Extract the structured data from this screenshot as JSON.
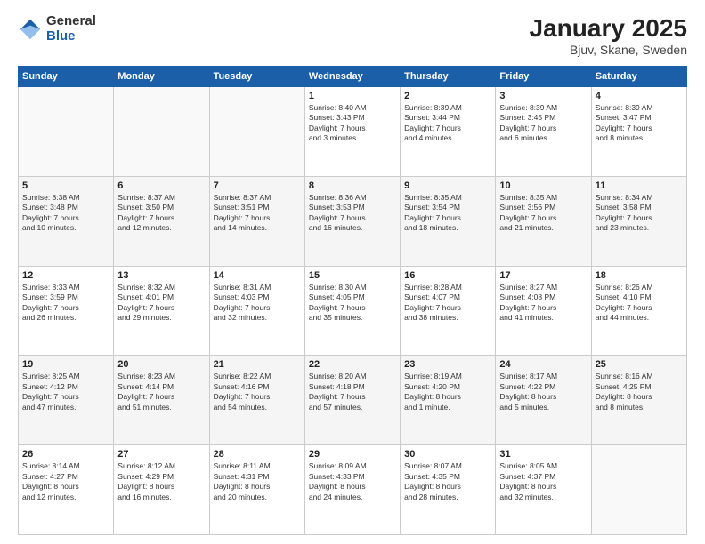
{
  "header": {
    "logo_general": "General",
    "logo_blue": "Blue",
    "title": "January 2025",
    "subtitle": "Bjuv, Skane, Sweden"
  },
  "days_of_week": [
    "Sunday",
    "Monday",
    "Tuesday",
    "Wednesday",
    "Thursday",
    "Friday",
    "Saturday"
  ],
  "weeks": [
    [
      {
        "day": "",
        "info": ""
      },
      {
        "day": "",
        "info": ""
      },
      {
        "day": "",
        "info": ""
      },
      {
        "day": "1",
        "info": "Sunrise: 8:40 AM\nSunset: 3:43 PM\nDaylight: 7 hours\nand 3 minutes."
      },
      {
        "day": "2",
        "info": "Sunrise: 8:39 AM\nSunset: 3:44 PM\nDaylight: 7 hours\nand 4 minutes."
      },
      {
        "day": "3",
        "info": "Sunrise: 8:39 AM\nSunset: 3:45 PM\nDaylight: 7 hours\nand 6 minutes."
      },
      {
        "day": "4",
        "info": "Sunrise: 8:39 AM\nSunset: 3:47 PM\nDaylight: 7 hours\nand 8 minutes."
      }
    ],
    [
      {
        "day": "5",
        "info": "Sunrise: 8:38 AM\nSunset: 3:48 PM\nDaylight: 7 hours\nand 10 minutes."
      },
      {
        "day": "6",
        "info": "Sunrise: 8:37 AM\nSunset: 3:50 PM\nDaylight: 7 hours\nand 12 minutes."
      },
      {
        "day": "7",
        "info": "Sunrise: 8:37 AM\nSunset: 3:51 PM\nDaylight: 7 hours\nand 14 minutes."
      },
      {
        "day": "8",
        "info": "Sunrise: 8:36 AM\nSunset: 3:53 PM\nDaylight: 7 hours\nand 16 minutes."
      },
      {
        "day": "9",
        "info": "Sunrise: 8:35 AM\nSunset: 3:54 PM\nDaylight: 7 hours\nand 18 minutes."
      },
      {
        "day": "10",
        "info": "Sunrise: 8:35 AM\nSunset: 3:56 PM\nDaylight: 7 hours\nand 21 minutes."
      },
      {
        "day": "11",
        "info": "Sunrise: 8:34 AM\nSunset: 3:58 PM\nDaylight: 7 hours\nand 23 minutes."
      }
    ],
    [
      {
        "day": "12",
        "info": "Sunrise: 8:33 AM\nSunset: 3:59 PM\nDaylight: 7 hours\nand 26 minutes."
      },
      {
        "day": "13",
        "info": "Sunrise: 8:32 AM\nSunset: 4:01 PM\nDaylight: 7 hours\nand 29 minutes."
      },
      {
        "day": "14",
        "info": "Sunrise: 8:31 AM\nSunset: 4:03 PM\nDaylight: 7 hours\nand 32 minutes."
      },
      {
        "day": "15",
        "info": "Sunrise: 8:30 AM\nSunset: 4:05 PM\nDaylight: 7 hours\nand 35 minutes."
      },
      {
        "day": "16",
        "info": "Sunrise: 8:28 AM\nSunset: 4:07 PM\nDaylight: 7 hours\nand 38 minutes."
      },
      {
        "day": "17",
        "info": "Sunrise: 8:27 AM\nSunset: 4:08 PM\nDaylight: 7 hours\nand 41 minutes."
      },
      {
        "day": "18",
        "info": "Sunrise: 8:26 AM\nSunset: 4:10 PM\nDaylight: 7 hours\nand 44 minutes."
      }
    ],
    [
      {
        "day": "19",
        "info": "Sunrise: 8:25 AM\nSunset: 4:12 PM\nDaylight: 7 hours\nand 47 minutes."
      },
      {
        "day": "20",
        "info": "Sunrise: 8:23 AM\nSunset: 4:14 PM\nDaylight: 7 hours\nand 51 minutes."
      },
      {
        "day": "21",
        "info": "Sunrise: 8:22 AM\nSunset: 4:16 PM\nDaylight: 7 hours\nand 54 minutes."
      },
      {
        "day": "22",
        "info": "Sunrise: 8:20 AM\nSunset: 4:18 PM\nDaylight: 7 hours\nand 57 minutes."
      },
      {
        "day": "23",
        "info": "Sunrise: 8:19 AM\nSunset: 4:20 PM\nDaylight: 8 hours\nand 1 minute."
      },
      {
        "day": "24",
        "info": "Sunrise: 8:17 AM\nSunset: 4:22 PM\nDaylight: 8 hours\nand 5 minutes."
      },
      {
        "day": "25",
        "info": "Sunrise: 8:16 AM\nSunset: 4:25 PM\nDaylight: 8 hours\nand 8 minutes."
      }
    ],
    [
      {
        "day": "26",
        "info": "Sunrise: 8:14 AM\nSunset: 4:27 PM\nDaylight: 8 hours\nand 12 minutes."
      },
      {
        "day": "27",
        "info": "Sunrise: 8:12 AM\nSunset: 4:29 PM\nDaylight: 8 hours\nand 16 minutes."
      },
      {
        "day": "28",
        "info": "Sunrise: 8:11 AM\nSunset: 4:31 PM\nDaylight: 8 hours\nand 20 minutes."
      },
      {
        "day": "29",
        "info": "Sunrise: 8:09 AM\nSunset: 4:33 PM\nDaylight: 8 hours\nand 24 minutes."
      },
      {
        "day": "30",
        "info": "Sunrise: 8:07 AM\nSunset: 4:35 PM\nDaylight: 8 hours\nand 28 minutes."
      },
      {
        "day": "31",
        "info": "Sunrise: 8:05 AM\nSunset: 4:37 PM\nDaylight: 8 hours\nand 32 minutes."
      },
      {
        "day": "",
        "info": ""
      }
    ]
  ]
}
